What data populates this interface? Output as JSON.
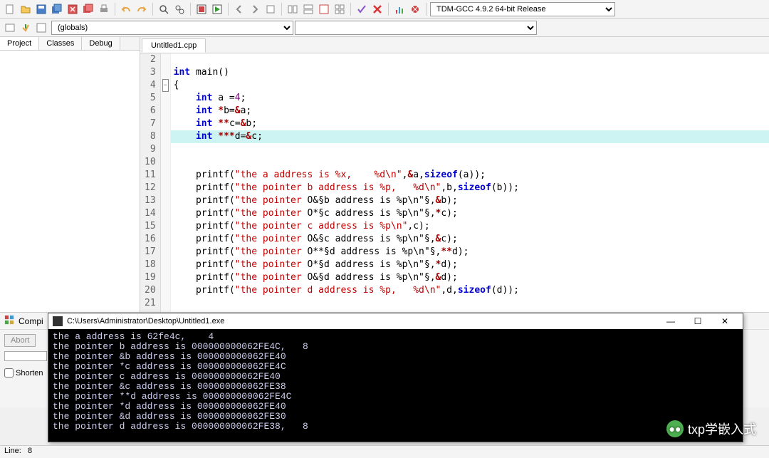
{
  "toolbar": {
    "compiler": "TDM-GCC 4.9.2 64-bit Release"
  },
  "globals_combo": "(globals)",
  "side_tabs": [
    "Project",
    "Classes",
    "Debug"
  ],
  "file_tab": "Untitled1.cpp",
  "code": {
    "start": 2,
    "lines": [
      {
        "n": 2,
        "t": ""
      },
      {
        "n": 3,
        "t": "int main()",
        "fold": ""
      },
      {
        "n": 4,
        "t": "{",
        "fold": "-"
      },
      {
        "n": 5,
        "t": "    int a =4;"
      },
      {
        "n": 6,
        "t": "    int *b=&a;"
      },
      {
        "n": 7,
        "t": "    int **c=&b;"
      },
      {
        "n": 8,
        "t": "    int ***d=&c;",
        "hl": true
      },
      {
        "n": 9,
        "t": ""
      },
      {
        "n": 10,
        "t": ""
      },
      {
        "n": 11,
        "t": "    printf(\"the a address is %x,    %d\\n\",&a,sizeof(a));"
      },
      {
        "n": 12,
        "t": "    printf(\"the pointer b address is %p,   %d\\n\",b,sizeof(b));"
      },
      {
        "n": 13,
        "t": "    printf(\"the pointer &b address is %p\\n\",&b);"
      },
      {
        "n": 14,
        "t": "    printf(\"the pointer *c address is %p\\n\",*c);"
      },
      {
        "n": 15,
        "t": "    printf(\"the pointer c address is %p\\n\",c);"
      },
      {
        "n": 16,
        "t": "    printf(\"the pointer &c address is %p\\n\",&c);"
      },
      {
        "n": 17,
        "t": "    printf(\"the pointer **d address is %p\\n\",**d);"
      },
      {
        "n": 18,
        "t": "    printf(\"the pointer *d address is %p\\n\",*d);"
      },
      {
        "n": 19,
        "t": "    printf(\"the pointer &d address is %p\\n\",&d);"
      },
      {
        "n": 20,
        "t": "    printf(\"the pointer d address is %p,   %d\\n\",d,sizeof(d));"
      },
      {
        "n": 21,
        "t": ""
      }
    ]
  },
  "bottom": {
    "compile_label": "Compi",
    "abort": "Abort",
    "shorten": "Shorten"
  },
  "console": {
    "title": "C:\\Users\\Administrator\\Desktop\\Untitled1.exe",
    "lines": [
      "the a address is 62fe4c,    4",
      "the pointer b address is 000000000062FE4C,   8",
      "the pointer &b address is 000000000062FE40",
      "the pointer *c address is 000000000062FE4C",
      "the pointer c address is 000000000062FE40",
      "the pointer &c address is 000000000062FE38",
      "the pointer **d address is 000000000062FE4C",
      "the pointer *d address is 000000000062FE40",
      "the pointer &d address is 000000000062FE30",
      "the pointer d address is 000000000062FE38,   8"
    ]
  },
  "status": {
    "line_label": "Line:",
    "line_val": "8"
  },
  "watermark": "txp学嵌入式"
}
